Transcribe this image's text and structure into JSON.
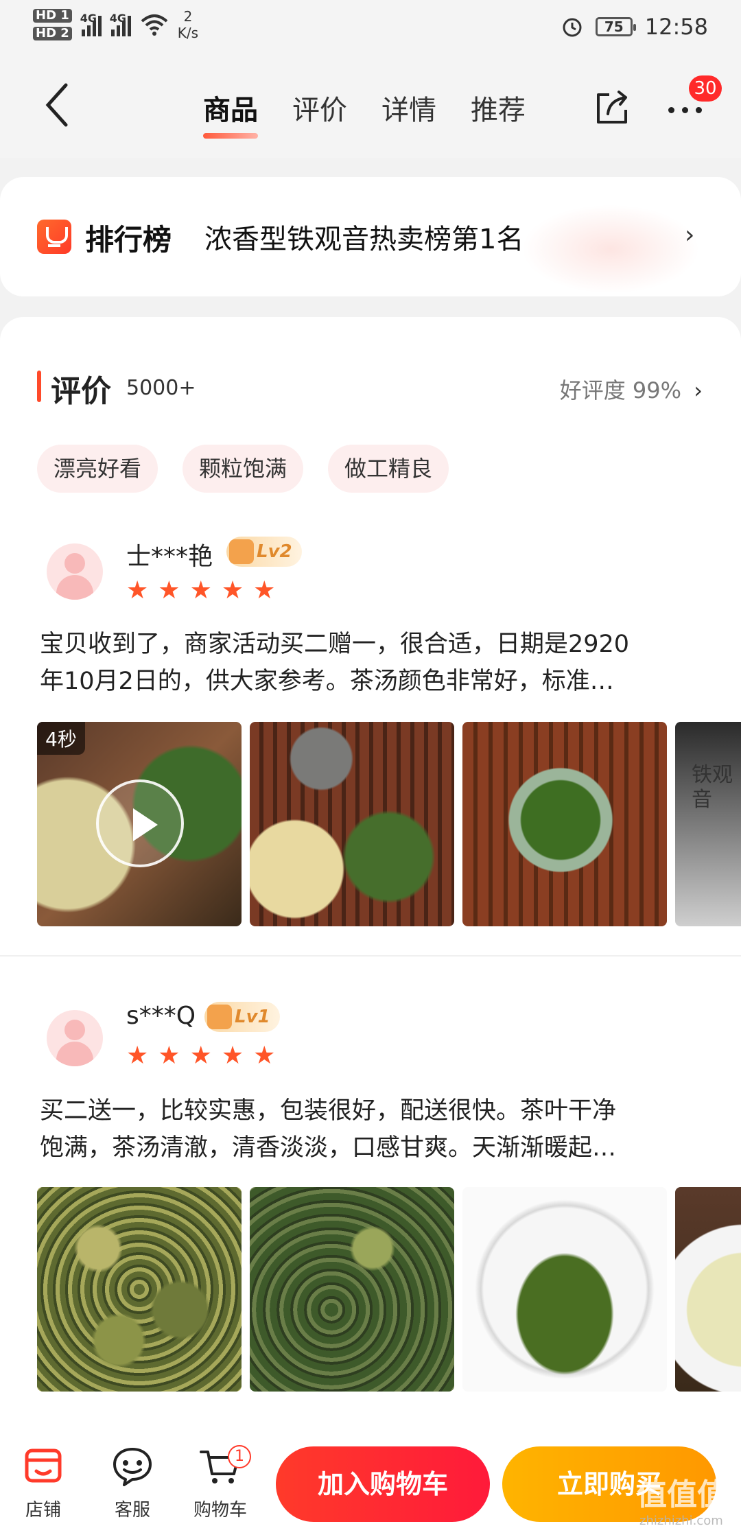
{
  "status_bar": {
    "sim1": "HD 1",
    "sim2": "HD 2",
    "net1": "4G",
    "net2": "4G",
    "speed_value": "2",
    "speed_unit": "K/s",
    "battery": "75",
    "time": "12:58",
    "icons": [
      "signal-icon",
      "wifi-icon",
      "alarm-icon",
      "battery-icon"
    ]
  },
  "nav": {
    "tabs": [
      {
        "label": "商品",
        "active": true
      },
      {
        "label": "评价",
        "active": false
      },
      {
        "label": "详情",
        "active": false
      },
      {
        "label": "推荐",
        "active": false
      }
    ],
    "more_badge": "30",
    "icons": [
      "back-arrow-icon",
      "share-icon",
      "more-dots-icon"
    ]
  },
  "ranking": {
    "title": "排行榜",
    "text": "浓香型铁观音热卖榜第1名",
    "arrow": "›"
  },
  "reviews_section": {
    "title": "评价",
    "count": "5000+",
    "good_rate": "好评度 99%",
    "arrow": "›",
    "tags": [
      "漂亮好看",
      "颗粒饱满",
      "做工精良"
    ],
    "items": [
      {
        "user": "士***艳",
        "level": "Lv2",
        "rating": 5,
        "stars": "★",
        "text_line1": "宝贝收到了，商家活动买二赠一，很合适，日期是2920",
        "text_line2": "年10月2日的，供大家参考。茶汤颜色非常好，标准…",
        "video_tag": "4秒",
        "package_text": "铁观音"
      },
      {
        "user": "s***Q",
        "level": "Lv1",
        "rating": 5,
        "stars": "★",
        "text_line1": "买二送一，比较实惠，包装很好，配送很快。茶叶干净",
        "text_line2": "饱满，茶汤清澈，清香淡淡，口感甘爽。天渐渐暖起…"
      }
    ]
  },
  "bottom_bar": {
    "shop": "店铺",
    "service": "客服",
    "cart": "购物车",
    "cart_badge": "1",
    "add_to_cart": "加入购物车",
    "buy_now": "立即购买"
  },
  "watermark": {
    "text": "值值值",
    "sub": "zhizhizhi.com"
  },
  "colors": {
    "accent_red": "#ff3a2a",
    "buy_orange": "#ffa800",
    "star": "#ff5528"
  }
}
